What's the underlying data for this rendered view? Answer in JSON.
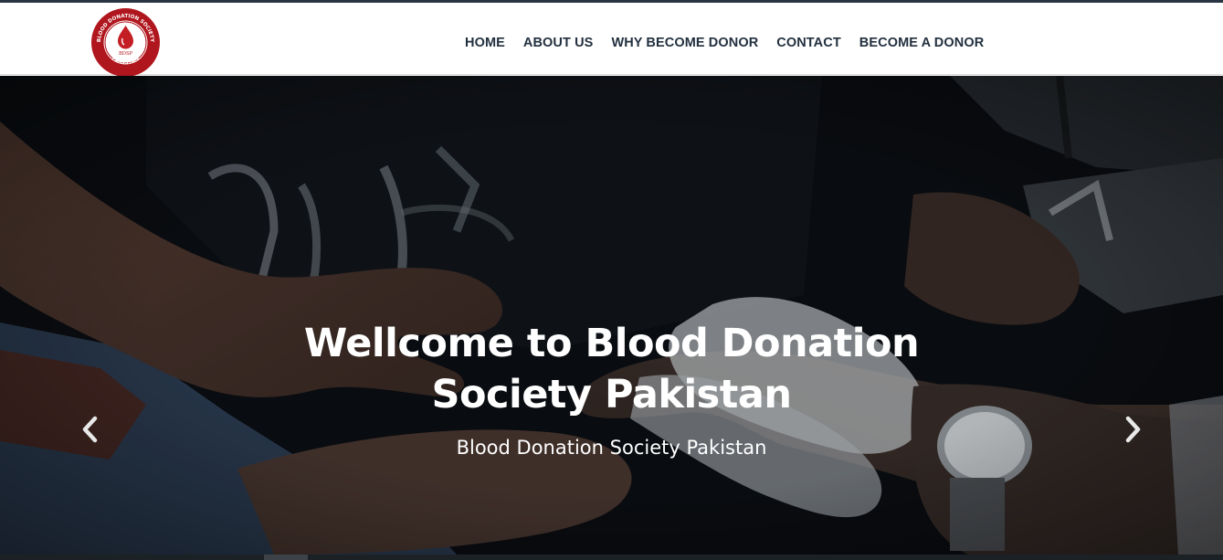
{
  "brand": {
    "logo_ring_top": "BLOOD DONATION SOCIETY",
    "logo_ring_bottom": "PAKISTAN",
    "logo_center": "BDSP",
    "color_primary": "#b0161d"
  },
  "nav": {
    "items": [
      {
        "label": "HOME"
      },
      {
        "label": "ABOUT US"
      },
      {
        "label": "WHY BECOME DONOR"
      },
      {
        "label": "CONTACT"
      },
      {
        "label": "BECOME A DONOR"
      }
    ],
    "text_color": "#23303f"
  },
  "hero": {
    "title_line1": "Wellcome to Blood Donation",
    "title_line2": "Society Pakistan",
    "subtitle": "Blood Donation Society Pakistan",
    "prev_icon": "chevron-left-icon",
    "next_icon": "chevron-right-icon"
  }
}
